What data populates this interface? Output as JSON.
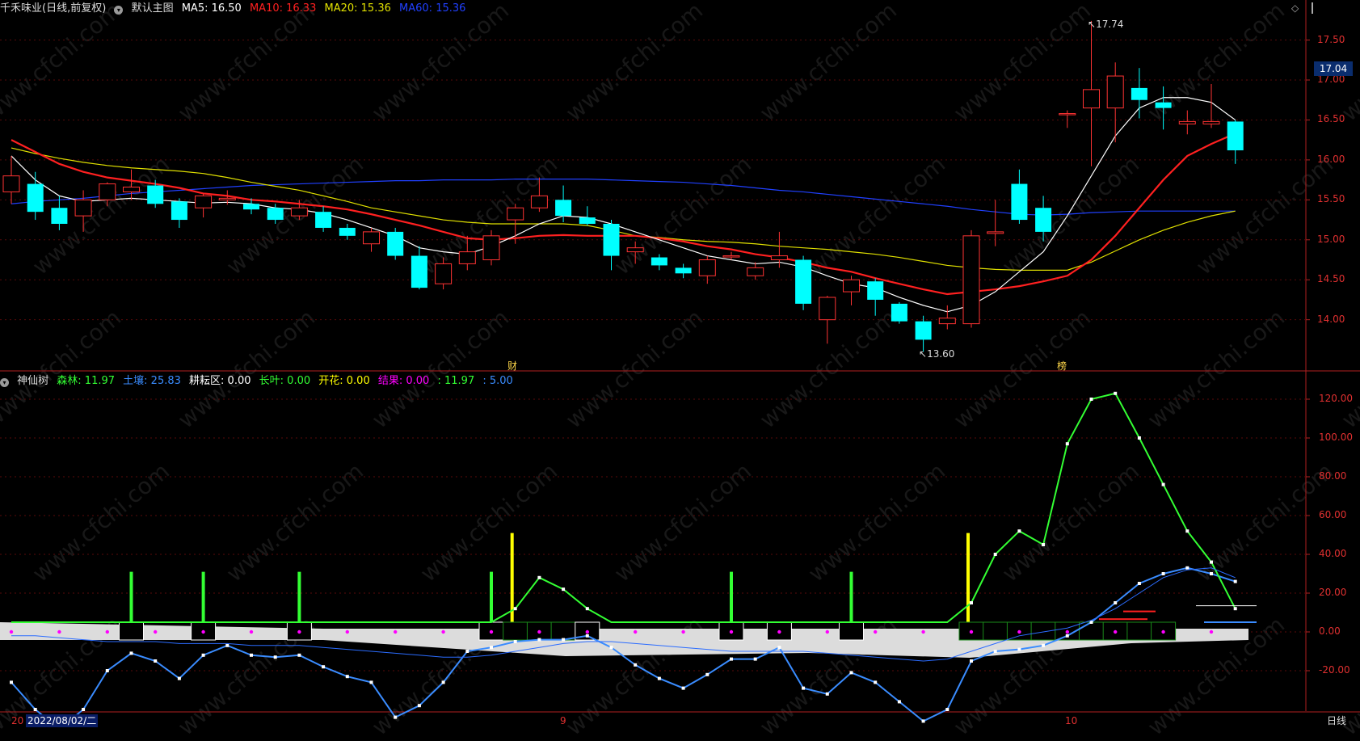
{
  "main_header": {
    "stock": "千禾味业(日线,前复权)",
    "template": "默认主图",
    "ma5_label": "MA5: 16.50",
    "ma10_label": "MA10: 16.33",
    "ma20_label": "MA20: 15.36",
    "ma60_label": "MA60: 15.36"
  },
  "indicator_header": {
    "name": "神仙树",
    "forest": "森林: 11.97",
    "soil": "土壤: 25.83",
    "farm": "耕耘区: 0.00",
    "leaf": "长叶: 0.00",
    "bloom": "开花: 0.00",
    "fruit": "结果: 0.00",
    "extra1": ": 11.97",
    "extra2": ": 5.00"
  },
  "price_axis_labels": [
    "17.50",
    "17.00",
    "16.50",
    "16.00",
    "15.50",
    "15.00",
    "14.50",
    "14.00"
  ],
  "indicator_axis_labels": [
    "120.00",
    "100.00",
    "80.00",
    "60.00",
    "40.00",
    "20.00",
    "0.00",
    "-20.00"
  ],
  "current_price_badge": "17.04",
  "annotations": {
    "high": "17.74",
    "low": "13.60",
    "cai": "财",
    "bang": "榜"
  },
  "bottom_bar": {
    "start_label": "20",
    "date": "2022/08/02/二",
    "month_9": "9",
    "month_10": "10",
    "period": "日线"
  },
  "colors": {
    "up": "#ff3333",
    "down": "#00ffff",
    "ma5": "#ffffff",
    "ma10": "#ff2020",
    "ma20": "#e0e000",
    "ma60": "#2040ff",
    "forest": "#33ff33",
    "soil": "#3a8cff",
    "fruit": "#ff00ff",
    "bloom": "#ffff00"
  },
  "chart_data": [
    {
      "type": "candlestick",
      "ylim": [
        13.4,
        17.9
      ],
      "ticks": [
        14.0,
        14.5,
        15.0,
        15.5,
        16.0,
        16.5,
        17.0,
        17.5
      ],
      "candles": [
        {
          "o": 15.6,
          "c": 15.8,
          "h": 16.05,
          "l": 15.45
        },
        {
          "o": 15.7,
          "c": 15.35,
          "h": 15.85,
          "l": 15.25
        },
        {
          "o": 15.4,
          "c": 15.2,
          "h": 15.55,
          "l": 15.12
        },
        {
          "o": 15.3,
          "c": 15.5,
          "h": 15.62,
          "l": 15.1
        },
        {
          "o": 15.5,
          "c": 15.7,
          "h": 15.72,
          "l": 15.42
        },
        {
          "o": 15.6,
          "c": 15.66,
          "h": 15.88,
          "l": 15.5
        },
        {
          "o": 15.68,
          "c": 15.45,
          "h": 15.75,
          "l": 15.4
        },
        {
          "o": 15.48,
          "c": 15.25,
          "h": 15.52,
          "l": 15.15
        },
        {
          "o": 15.4,
          "c": 15.55,
          "h": 15.58,
          "l": 15.28
        },
        {
          "o": 15.5,
          "c": 15.52,
          "h": 15.62,
          "l": 15.44
        },
        {
          "o": 15.45,
          "c": 15.38,
          "h": 15.52,
          "l": 15.32
        },
        {
          "o": 15.4,
          "c": 15.25,
          "h": 15.45,
          "l": 15.2
        },
        {
          "o": 15.3,
          "c": 15.4,
          "h": 15.5,
          "l": 15.25
        },
        {
          "o": 15.35,
          "c": 15.15,
          "h": 15.42,
          "l": 15.1
        },
        {
          "o": 15.15,
          "c": 15.05,
          "h": 15.2,
          "l": 15.0
        },
        {
          "o": 14.95,
          "c": 15.1,
          "h": 15.15,
          "l": 14.85
        },
        {
          "o": 15.1,
          "c": 14.8,
          "h": 15.15,
          "l": 14.75
        },
        {
          "o": 14.8,
          "c": 14.4,
          "h": 14.92,
          "l": 14.38
        },
        {
          "o": 14.45,
          "c": 14.7,
          "h": 14.78,
          "l": 14.38
        },
        {
          "o": 14.7,
          "c": 14.85,
          "h": 15.05,
          "l": 14.62
        },
        {
          "o": 14.75,
          "c": 15.05,
          "h": 15.12,
          "l": 14.68
        },
        {
          "o": 15.25,
          "c": 15.4,
          "h": 15.45,
          "l": 14.95
        },
        {
          "o": 15.4,
          "c": 15.55,
          "h": 15.78,
          "l": 15.35
        },
        {
          "o": 15.5,
          "c": 15.3,
          "h": 15.68,
          "l": 15.22
        },
        {
          "o": 15.28,
          "c": 15.2,
          "h": 15.42,
          "l": 15.18
        },
        {
          "o": 15.2,
          "c": 14.8,
          "h": 15.25,
          "l": 14.62
        },
        {
          "o": 14.85,
          "c": 14.9,
          "h": 14.98,
          "l": 14.7
        },
        {
          "o": 14.78,
          "c": 14.68,
          "h": 14.82,
          "l": 14.62
        },
        {
          "o": 14.65,
          "c": 14.58,
          "h": 14.7,
          "l": 14.52
        },
        {
          "o": 14.55,
          "c": 14.75,
          "h": 14.8,
          "l": 14.45
        },
        {
          "o": 14.8,
          "c": 14.8,
          "h": 14.85,
          "l": 14.75
        },
        {
          "o": 14.55,
          "c": 14.65,
          "h": 14.72,
          "l": 14.5
        },
        {
          "o": 14.75,
          "c": 14.8,
          "h": 15.1,
          "l": 14.65
        },
        {
          "o": 14.75,
          "c": 14.2,
          "h": 14.8,
          "l": 14.12
        },
        {
          "o": 14.0,
          "c": 14.28,
          "h": 14.3,
          "l": 13.7
        },
        {
          "o": 14.35,
          "c": 14.5,
          "h": 14.55,
          "l": 14.18
        },
        {
          "o": 14.48,
          "c": 14.25,
          "h": 14.52,
          "l": 14.05
        },
        {
          "o": 14.2,
          "c": 13.98,
          "h": 14.22,
          "l": 13.95
        },
        {
          "o": 13.98,
          "c": 13.75,
          "h": 14.05,
          "l": 13.6
        },
        {
          "o": 13.95,
          "c": 14.02,
          "h": 14.18,
          "l": 13.88
        },
        {
          "o": 13.95,
          "c": 15.05,
          "h": 15.12,
          "l": 13.9
        },
        {
          "o": 15.08,
          "c": 15.1,
          "h": 15.5,
          "l": 14.92
        },
        {
          "o": 15.7,
          "c": 15.25,
          "h": 15.88,
          "l": 15.2
        },
        {
          "o": 15.4,
          "c": 15.1,
          "h": 15.55,
          "l": 14.98
        },
        {
          "o": 16.58,
          "c": 16.58,
          "h": 16.62,
          "l": 16.4
        },
        {
          "o": 16.65,
          "c": 16.88,
          "h": 17.74,
          "l": 15.92
        },
        {
          "o": 16.65,
          "c": 17.05,
          "h": 17.22,
          "l": 16.22
        },
        {
          "o": 16.9,
          "c": 16.75,
          "h": 17.15,
          "l": 16.52
        },
        {
          "o": 16.72,
          "c": 16.65,
          "h": 16.92,
          "l": 16.38
        },
        {
          "o": 16.45,
          "c": 16.48,
          "h": 16.62,
          "l": 16.32
        },
        {
          "o": 16.45,
          "c": 16.48,
          "h": 16.95,
          "l": 16.4
        },
        {
          "o": 16.48,
          "c": 16.12,
          "h": 16.5,
          "l": 15.95
        }
      ],
      "ma5": [
        16.05,
        15.75,
        15.55,
        15.48,
        15.5,
        15.52,
        15.5,
        15.48,
        15.46,
        15.47,
        15.45,
        15.4,
        15.38,
        15.33,
        15.25,
        15.15,
        15.05,
        14.9,
        14.85,
        14.82,
        14.92,
        15.05,
        15.2,
        15.3,
        15.28,
        15.2,
        15.1,
        15.0,
        14.9,
        14.8,
        14.75,
        14.7,
        14.72,
        14.66,
        14.55,
        14.45,
        14.4,
        14.28,
        14.18,
        14.1,
        14.18,
        14.35,
        14.6,
        14.85,
        15.3,
        15.8,
        16.3,
        16.65,
        16.78,
        16.78,
        16.72,
        16.5
      ],
      "ma10": [
        16.25,
        16.1,
        15.95,
        15.85,
        15.78,
        15.74,
        15.7,
        15.65,
        15.58,
        15.55,
        15.5,
        15.48,
        15.45,
        15.42,
        15.38,
        15.32,
        15.25,
        15.18,
        15.1,
        15.02,
        15.0,
        15.02,
        15.05,
        15.06,
        15.05,
        15.05,
        15.05,
        15.02,
        14.98,
        14.92,
        14.88,
        14.82,
        14.78,
        14.72,
        14.65,
        14.6,
        14.52,
        14.45,
        14.38,
        14.32,
        14.35,
        14.38,
        14.42,
        14.48,
        14.55,
        14.75,
        15.05,
        15.4,
        15.75,
        16.05,
        16.2,
        16.33
      ],
      "ma20": [
        16.15,
        16.08,
        16.02,
        15.97,
        15.93,
        15.9,
        15.88,
        15.86,
        15.83,
        15.78,
        15.72,
        15.67,
        15.62,
        15.55,
        15.48,
        15.4,
        15.35,
        15.3,
        15.25,
        15.22,
        15.2,
        15.2,
        15.2,
        15.2,
        15.18,
        15.12,
        15.05,
        15.03,
        15.0,
        14.98,
        14.97,
        14.95,
        14.92,
        14.9,
        14.88,
        14.85,
        14.82,
        14.78,
        14.73,
        14.68,
        14.65,
        14.63,
        14.62,
        14.62,
        14.62,
        14.72,
        14.86,
        15.0,
        15.12,
        15.22,
        15.3,
        15.36
      ],
      "ma60": [
        15.45,
        15.48,
        15.5,
        15.52,
        15.55,
        15.58,
        15.6,
        15.62,
        15.64,
        15.66,
        15.68,
        15.69,
        15.7,
        15.71,
        15.72,
        15.73,
        15.74,
        15.74,
        15.75,
        15.75,
        15.75,
        15.76,
        15.76,
        15.76,
        15.76,
        15.75,
        15.74,
        15.73,
        15.72,
        15.7,
        15.68,
        15.65,
        15.62,
        15.6,
        15.57,
        15.54,
        15.51,
        15.48,
        15.45,
        15.42,
        15.38,
        15.35,
        15.32,
        15.31,
        15.32,
        15.34,
        15.35,
        15.36,
        15.36,
        15.36,
        15.36,
        15.36
      ]
    },
    {
      "type": "line",
      "ylim": [
        -40,
        130
      ],
      "ticks": [
        -20,
        0,
        20,
        40,
        60,
        80,
        100,
        120
      ],
      "series": [
        {
          "name": "森林",
          "values": [
            5,
            5,
            5,
            5,
            5,
            5,
            5,
            5,
            5,
            5,
            5,
            5,
            5,
            5,
            5,
            5,
            5,
            5,
            5,
            5,
            5,
            12,
            28,
            22,
            12,
            5,
            5,
            5,
            5,
            5,
            5,
            5,
            5,
            5,
            5,
            5,
            5,
            5,
            5,
            5,
            15,
            40,
            52,
            45,
            97,
            120,
            123,
            100,
            76,
            52,
            36,
            12
          ]
        },
        {
          "name": "土壤",
          "values": [
            -26,
            -40,
            -50,
            -40,
            -20,
            -11,
            -15,
            -24,
            -12,
            -7,
            -12,
            -13,
            -12,
            -18,
            -23,
            -26,
            -44,
            -38,
            -26,
            -10,
            -8,
            -5,
            -4,
            -4,
            -2,
            -8,
            -17,
            -24,
            -29,
            -22,
            -14,
            -14,
            -8,
            -29,
            -32,
            -21,
            -26,
            -36,
            -46,
            -40,
            -15,
            -10,
            -9,
            -7,
            -2,
            5,
            15,
            25,
            30,
            33,
            30,
            26
          ]
        }
      ],
      "bloom_spikes": [
        21,
        40
      ],
      "forest_spikes": [
        5,
        8,
        12,
        20,
        30,
        35
      ]
    }
  ]
}
